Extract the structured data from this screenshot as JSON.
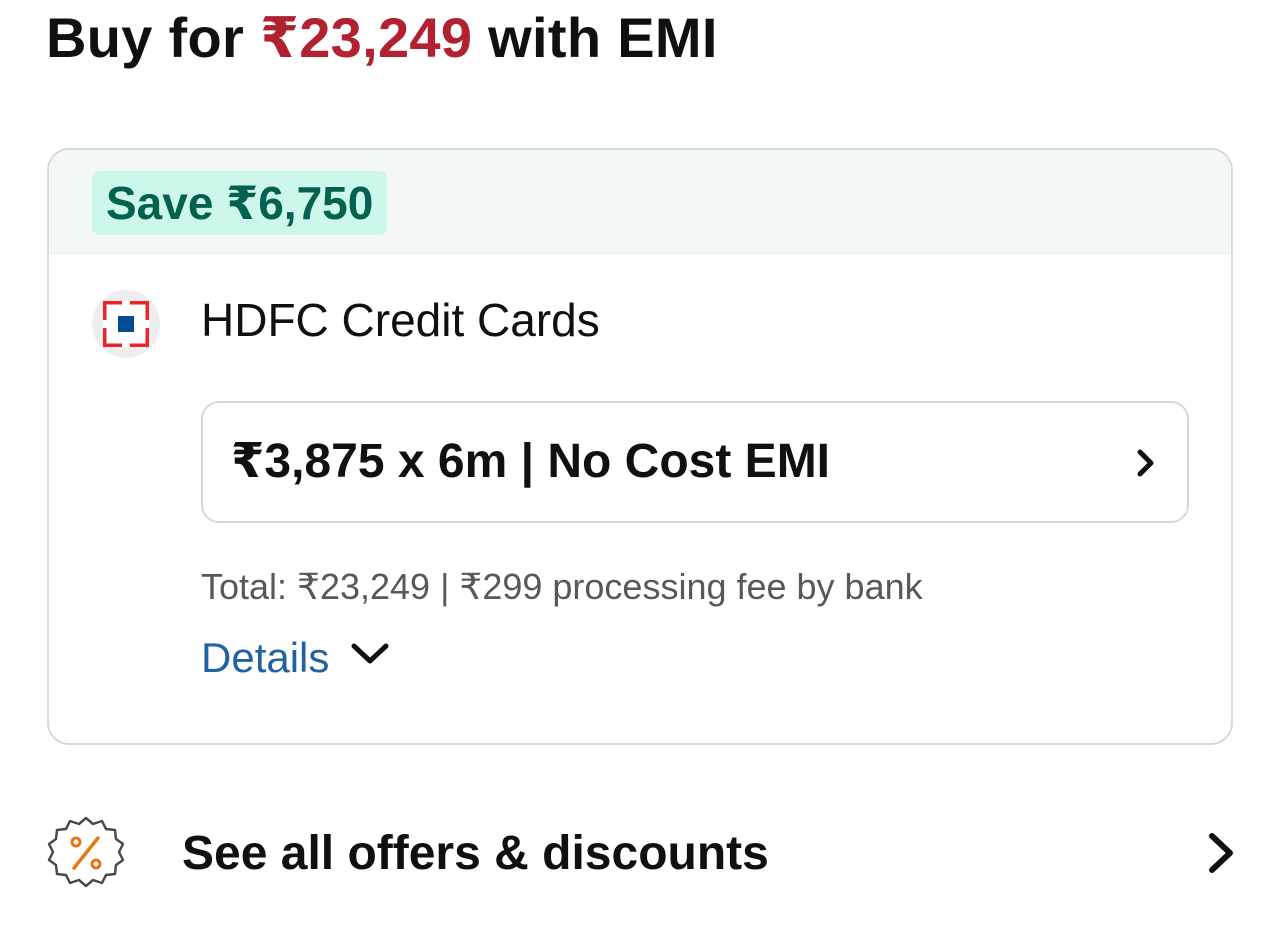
{
  "headline": {
    "prefix": "Buy for ",
    "price": "₹23,249",
    "suffix": " with EMI"
  },
  "emi_card": {
    "save_badge": "Save ₹6,750",
    "bank": {
      "name": "HDFC Credit Cards",
      "logo_icon": "hdfc-bank-logo"
    },
    "plan": {
      "label": "₹3,875 x 6m | No Cost EMI",
      "icon": "chevron-right-icon"
    },
    "total_text": "Total: ₹23,249 | ₹299 processing fee by bank",
    "details": {
      "label": "Details",
      "icon": "chevron-down-icon"
    }
  },
  "offers": {
    "label": "See all offers & discounts",
    "icon": "percent-badge-icon",
    "chevron_icon": "chevron-right-icon"
  },
  "colors": {
    "price_red": "#b12130",
    "save_badge_bg": "#cdf7ea",
    "save_badge_text": "#05614f",
    "link_blue": "#2162a1",
    "muted_text": "#565959",
    "border": "#d5d9d9",
    "offer_icon_orange": "#e47911",
    "hdfc_red": "#ed232a",
    "hdfc_blue": "#004c8f"
  }
}
